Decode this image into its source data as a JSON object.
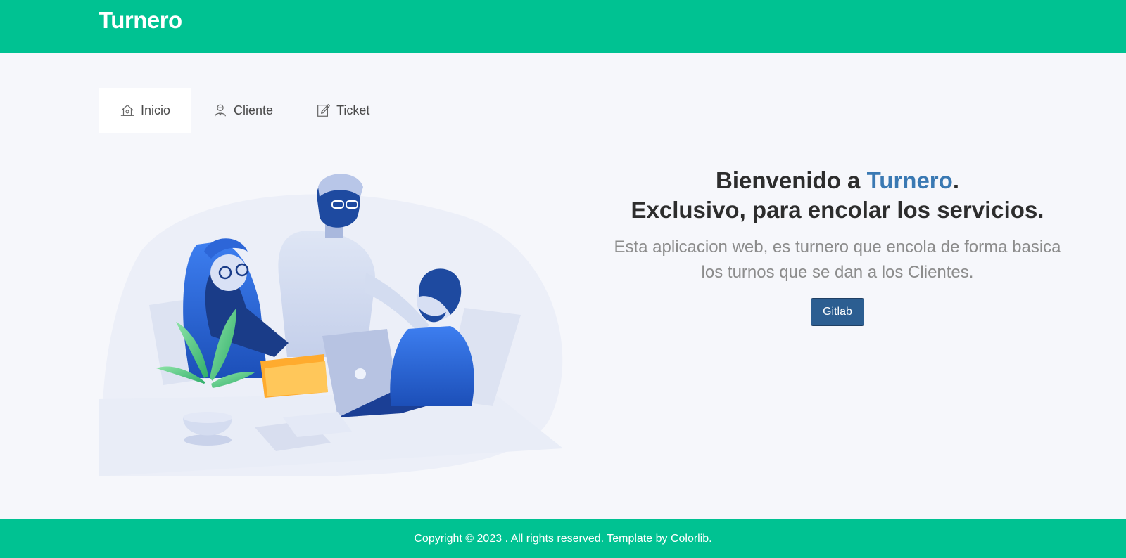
{
  "header": {
    "brand": "Turnero"
  },
  "tabs": [
    {
      "label": "Inicio",
      "icon": "home-icon",
      "active": true
    },
    {
      "label": "Cliente",
      "icon": "user-icon",
      "active": false
    },
    {
      "label": "Ticket",
      "icon": "edit-note-icon",
      "active": false
    }
  ],
  "hero": {
    "title_prefix": "Bienvenido a ",
    "title_accent": "Turnero",
    "title_suffix": ".",
    "title_line2": "Exclusivo, para encolar los servicios.",
    "subtitle_line1": "Esta aplicacion web, es turnero que encola de forma basica",
    "subtitle_line2": "los turnos que se dan a los Clientes.",
    "button_label": "Gitlab"
  },
  "footer": {
    "text": "Copyright © 2023 . All rights reserved. Template by Colorlib."
  },
  "colors": {
    "brand_green": "#00c292",
    "accent_blue": "#3a79b3",
    "button_blue": "#2c5e91",
    "page_bg": "#f6f7fb"
  }
}
